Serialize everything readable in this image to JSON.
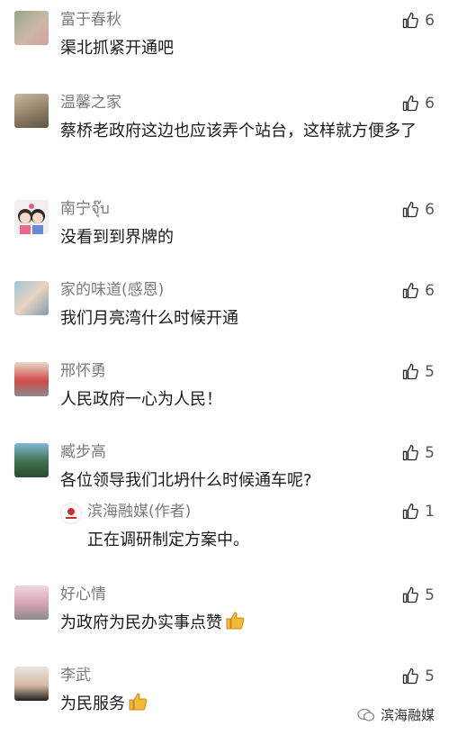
{
  "comments": [
    {
      "user": "富于春秋",
      "text": "渠北抓紧开通吧",
      "likes": "6",
      "avatar": "avatar-flowers"
    },
    {
      "user": "温馨之家",
      "text": "蔡桥老政府这边也应该弄个站台，这样就方便多了",
      "likes": "6",
      "avatar": "avatar-room"
    },
    {
      "user": "南宁จุ๊บ",
      "text": "没看到到界牌的",
      "likes": "6",
      "avatar": "avatar-cartoon-couple"
    },
    {
      "user": "家的味道(感恩)",
      "text": "我们月亮湾什么时候开通",
      "likes": "6",
      "avatar": "avatar-family"
    },
    {
      "user": "邢怀勇",
      "text": "人民政府一心为人民！",
      "likes": "5",
      "avatar": "avatar-person"
    },
    {
      "user": "臧步高",
      "text": "各位领导我们北坍什么时候通车呢?",
      "likes": "5",
      "avatar": "avatar-landscape",
      "reply": {
        "user": "滨海融媒(作者)",
        "text": "正在调研制定方案中。",
        "likes": "1"
      }
    },
    {
      "user": "好心情",
      "text": "为政府为民办实事点赞",
      "likes": "5",
      "avatar": "avatar-blossom",
      "emoji": "thumbs-up-emoji"
    },
    {
      "user": "李武",
      "text": "为民服务",
      "likes": "5",
      "avatar": "avatar-man",
      "emoji": "thumbs-up-emoji"
    }
  ],
  "watermark": {
    "label": "滨海融媒"
  },
  "colors": {
    "name": "#7a7a7a",
    "text": "#1a1a1a",
    "like_icon": "#2a2a2a"
  }
}
